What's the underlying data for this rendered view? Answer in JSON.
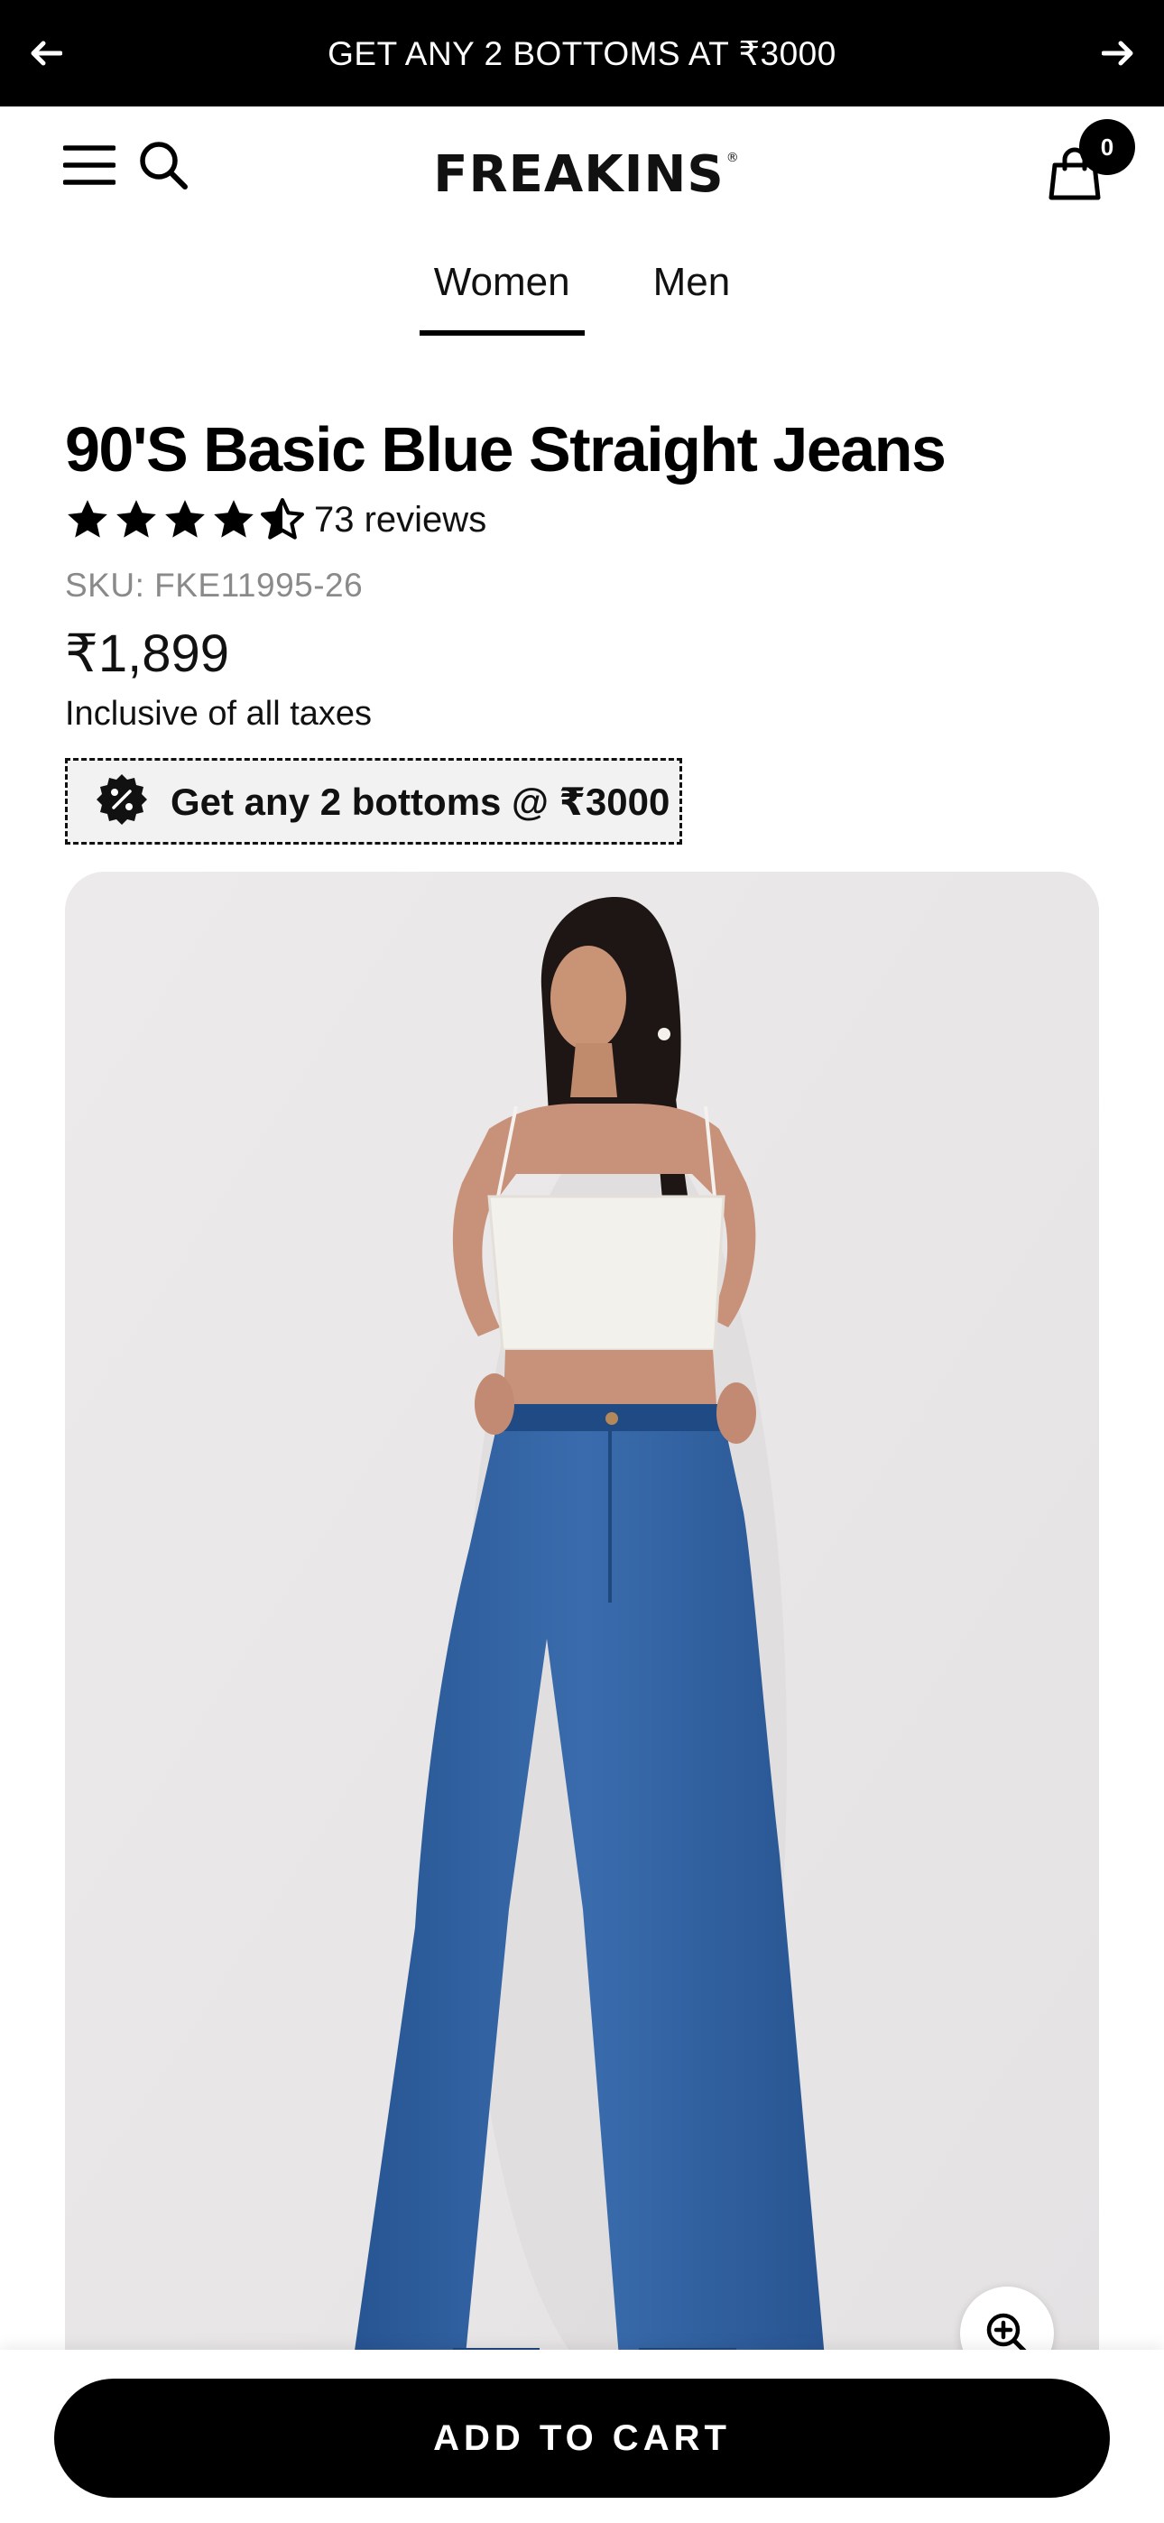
{
  "announcement": {
    "text": "GET ANY 2 BOTTOMS AT ₹3000",
    "prev_icon": "arrow-left-icon",
    "next_icon": "arrow-right-icon"
  },
  "header": {
    "logo": "FREAKINS",
    "logo_mark": "®",
    "menu_icon": "hamburger-menu-icon",
    "search_icon": "search-icon",
    "cart_icon": "shopping-bag-icon",
    "cart_count": "0"
  },
  "tabs": [
    {
      "label": "Women",
      "active": true
    },
    {
      "label": "Men",
      "active": false
    }
  ],
  "product": {
    "title": "90'S Basic Blue Straight Jeans",
    "rating": 4.5,
    "rating_max": 5,
    "reviews": "73 reviews",
    "sku": "SKU: FKE11995-26",
    "price": "₹1,899",
    "tax_note": "Inclusive of all taxes",
    "offer_text": "Get any 2 bottoms @ ₹3000",
    "offer_icon": "discount-badge-icon"
  },
  "gallery": {
    "image": "model-in-white-crop-top-and-blue-straight-jeans",
    "zoom_icon": "zoom-in-icon"
  },
  "cta": {
    "label": "ADD TO CART"
  },
  "colors": {
    "primary": "#000000",
    "background": "#ffffff",
    "muted_text": "#8a8a8a",
    "offer_bg": "#f2f2f2",
    "image_bg": "#e9e7e7",
    "denim": "#2f5f9e"
  }
}
